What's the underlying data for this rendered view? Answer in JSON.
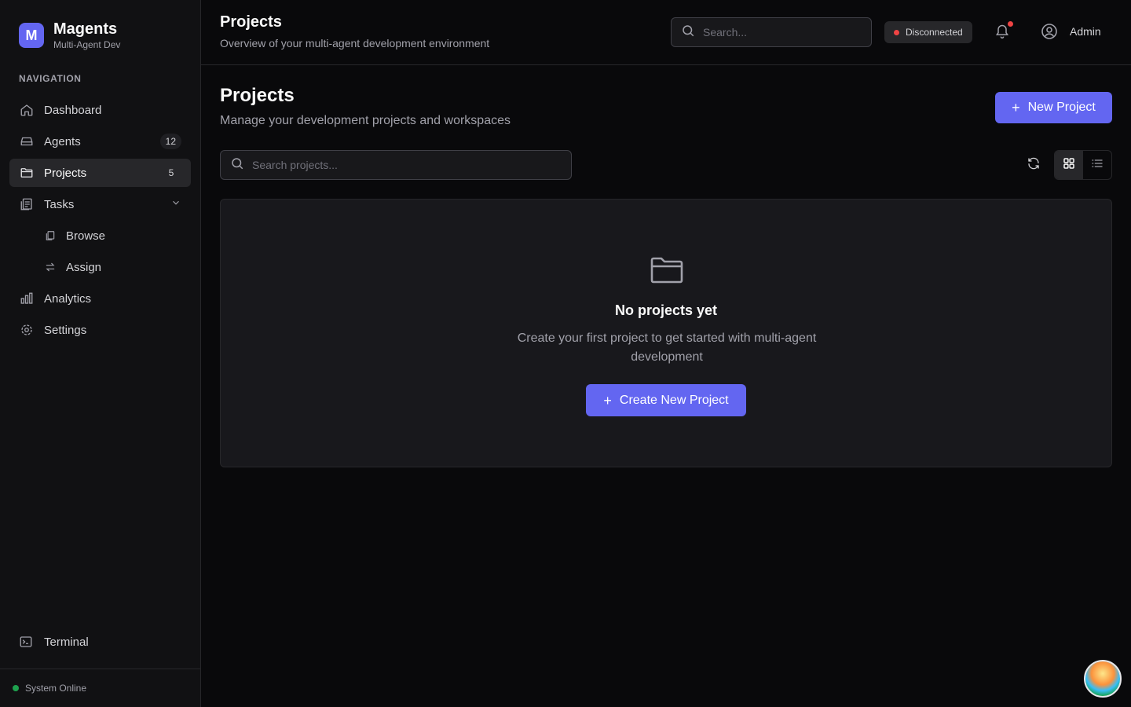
{
  "brand": {
    "logo_letter": "M",
    "name": "Magents",
    "subtitle": "Multi-Agent Dev"
  },
  "sidebar": {
    "section_label": "NAVIGATION",
    "items": [
      {
        "label": "Dashboard",
        "icon": "home-icon"
      },
      {
        "label": "Agents",
        "icon": "agents-icon",
        "badge": "12"
      },
      {
        "label": "Projects",
        "icon": "folder-icon",
        "badge": "5",
        "active": true
      },
      {
        "label": "Tasks",
        "icon": "tasks-icon",
        "expanded": true
      },
      {
        "label": "Browse",
        "icon": "browse-icon",
        "sub": true
      },
      {
        "label": "Assign",
        "icon": "assign-icon",
        "sub": true
      },
      {
        "label": "Analytics",
        "icon": "chart-icon"
      },
      {
        "label": "Settings",
        "icon": "gear-icon"
      }
    ],
    "terminal_label": "Terminal",
    "system_status": "System Online"
  },
  "header": {
    "title": "Projects",
    "subtitle": "Overview of your multi-agent development environment",
    "search_placeholder": "Search...",
    "connection_status": "Disconnected",
    "user_label": "Admin"
  },
  "main": {
    "title": "Projects",
    "subtitle": "Manage your development projects and workspaces",
    "new_project_label": "New Project",
    "search_placeholder": "Search projects...",
    "view_mode": "grid",
    "empty": {
      "title": "No projects yet",
      "description": "Create your first project to get started with multi-agent development",
      "button_label": "Create New Project"
    }
  },
  "colors": {
    "accent": "#6366f1",
    "danger": "#ef4444",
    "success": "#22c55e",
    "background": "#09090b",
    "sidebar": "#111113"
  }
}
